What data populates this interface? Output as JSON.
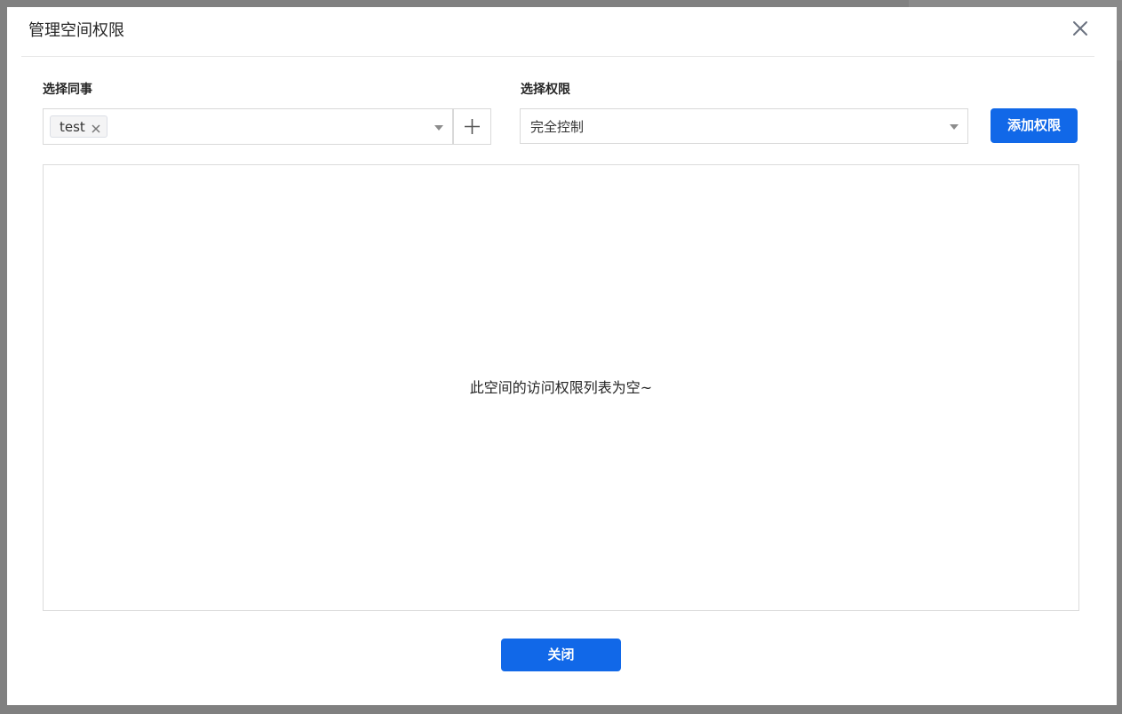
{
  "modal": {
    "title": "管理空间权限",
    "close_icon": "close-icon"
  },
  "colleague": {
    "label": "选择同事",
    "tags": [
      "test"
    ],
    "add_icon": "plus-icon"
  },
  "permission": {
    "label": "选择权限",
    "selected": "完全控制"
  },
  "buttons": {
    "add_permission": "添加权限",
    "close": "关闭"
  },
  "list": {
    "empty_message": "此空间的访问权限列表为空~"
  },
  "colors": {
    "primary": "#1168e8",
    "overlay": "#808080"
  }
}
